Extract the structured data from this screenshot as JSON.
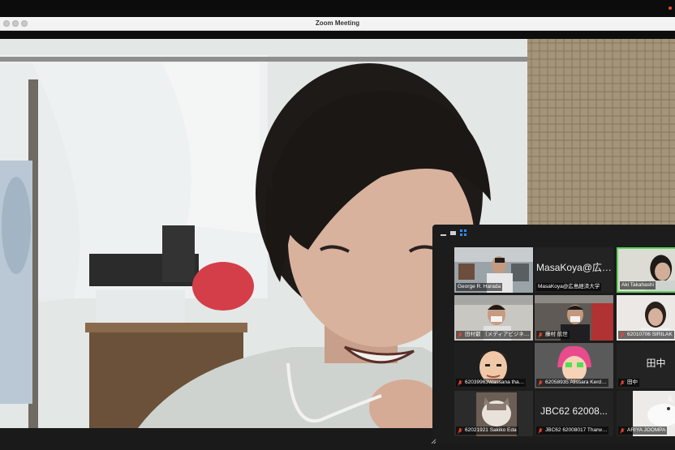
{
  "window": {
    "title": "Zoom Meeting"
  },
  "icons": {
    "close": "window-close-icon",
    "minimize": "window-minimize-icon",
    "maximize": "window-maximize-icon",
    "mute": "muted-microphone-icon"
  },
  "colors": {
    "active_speaker_border": "#5ed35e",
    "gallery_view_accent": "#2d8cff",
    "mute_red": "#e8452f"
  },
  "gallery": {
    "participants": [
      {
        "label": "George R. Harada",
        "muted": false,
        "display_text": "",
        "video": "office"
      },
      {
        "label": "MasaKoya@広島経済大学",
        "muted": false,
        "display_text": "MasaKoya@広…",
        "video": "none"
      },
      {
        "label": "Aki Takahashi",
        "muted": false,
        "display_text": "",
        "video": "woman",
        "active_speaker": true
      },
      {
        "label": "田村叡 （メディアビジネ…",
        "muted": true,
        "display_text": "",
        "video": "man-mask"
      },
      {
        "label": "藤村 航世",
        "muted": true,
        "display_text": "",
        "video": "man-mask-office"
      },
      {
        "label": "62010706 SIRILAK",
        "muted": true,
        "display_text": "",
        "video": "woman-2"
      },
      {
        "label": "62039963Wassana tha…",
        "muted": true,
        "display_text": "",
        "video": "cartoon-man"
      },
      {
        "label": "62058935 Alissara Kerd…",
        "muted": true,
        "display_text": "",
        "video": "cartoon-pink"
      },
      {
        "label": "田中",
        "muted": true,
        "display_text": "田中",
        "video": "none"
      },
      {
        "label": "62021921 Sakiko Eda",
        "muted": true,
        "display_text": "",
        "video": "cat"
      },
      {
        "label": "JBC62 62008017 Tharw…",
        "muted": true,
        "display_text": "JBC62 62008...",
        "video": "none"
      },
      {
        "label": "ARIYA JOOMPA",
        "muted": true,
        "display_text": "",
        "video": "white-cat"
      }
    ]
  }
}
